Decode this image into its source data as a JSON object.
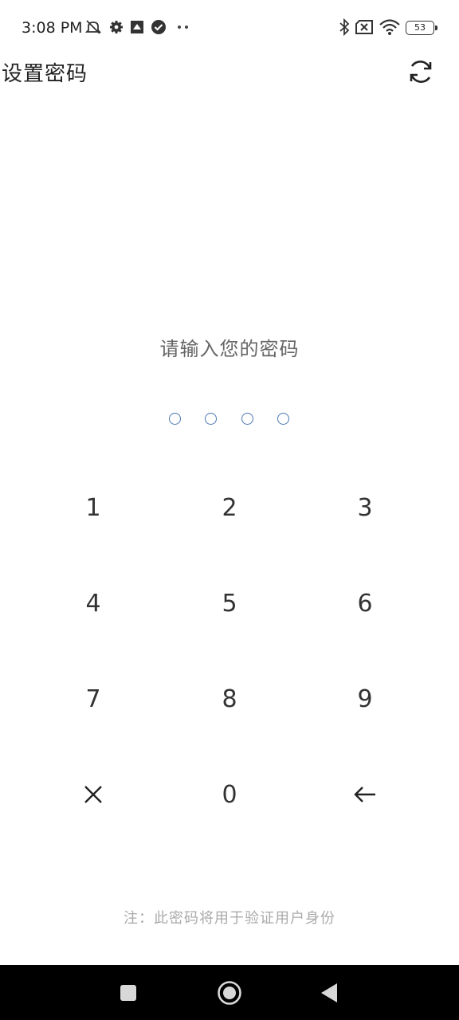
{
  "status_bar": {
    "time": "3:08 PM",
    "left_icons": [
      "muted-bell-icon",
      "gear-icon",
      "app-icon",
      "check-circle-icon",
      "more-dots-icon"
    ],
    "right_icons": [
      "bluetooth-icon",
      "sim-off-icon",
      "wifi-icon"
    ],
    "battery_level": "53"
  },
  "header": {
    "title": "设置密码",
    "refresh_icon": "refresh-icon"
  },
  "prompt": "请输入您的密码",
  "pin": {
    "length": 4,
    "filled": 0,
    "dot_color": "#4a78b0"
  },
  "keypad": {
    "keys": [
      "1",
      "2",
      "3",
      "4",
      "5",
      "6",
      "7",
      "8",
      "9",
      "×",
      "0",
      "←"
    ]
  },
  "footnote": "注：此密码将用于验证用户身份",
  "nav_bar": {
    "buttons": [
      "recents-square-icon",
      "home-circle-icon",
      "back-triangle-icon"
    ]
  }
}
